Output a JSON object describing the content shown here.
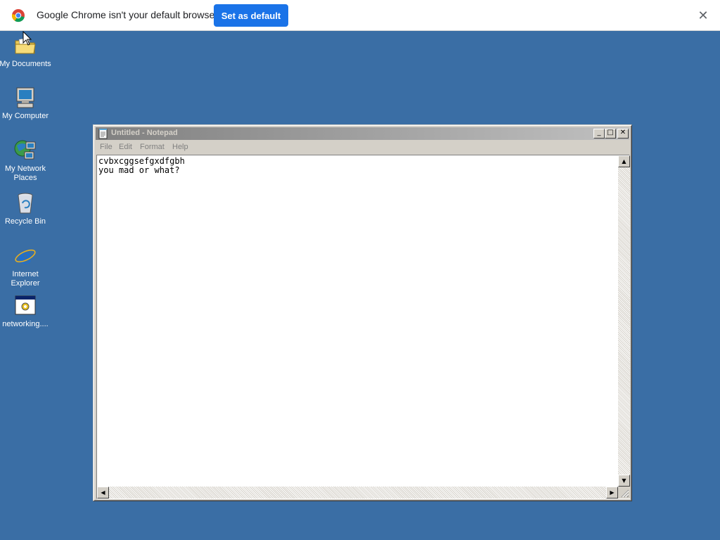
{
  "infobar": {
    "message": "Google Chrome isn't your default browser",
    "button_label": "Set as default",
    "close_glyph": "✕"
  },
  "desktop": {
    "icons": [
      {
        "label": "My Documents",
        "icon": "folder-icon"
      },
      {
        "label": "My Computer",
        "icon": "computer-icon"
      },
      {
        "label": "My Network Places",
        "icon": "network-icon"
      },
      {
        "label": "Recycle Bin",
        "icon": "recycle-bin-icon"
      },
      {
        "label": "Internet Explorer",
        "icon": "internet-explorer-icon"
      },
      {
        "label": "networking....",
        "icon": "program-icon"
      }
    ]
  },
  "notepad": {
    "title": "Untitled - Notepad",
    "menu": [
      "File",
      "Edit",
      "Format",
      "Help"
    ],
    "content": "cvbxcggsefgxdfgbh\nyou mad or what?",
    "buttons": {
      "minimize": "_",
      "maximize": "□",
      "close": "✕"
    }
  },
  "colors": {
    "desktop_bg": "#3a6ea5",
    "chrome_button": "#1a73e8",
    "window_face": "#d4d0c8",
    "title_inactive_start": "#808080",
    "title_inactive_end": "#c0c0c0"
  }
}
